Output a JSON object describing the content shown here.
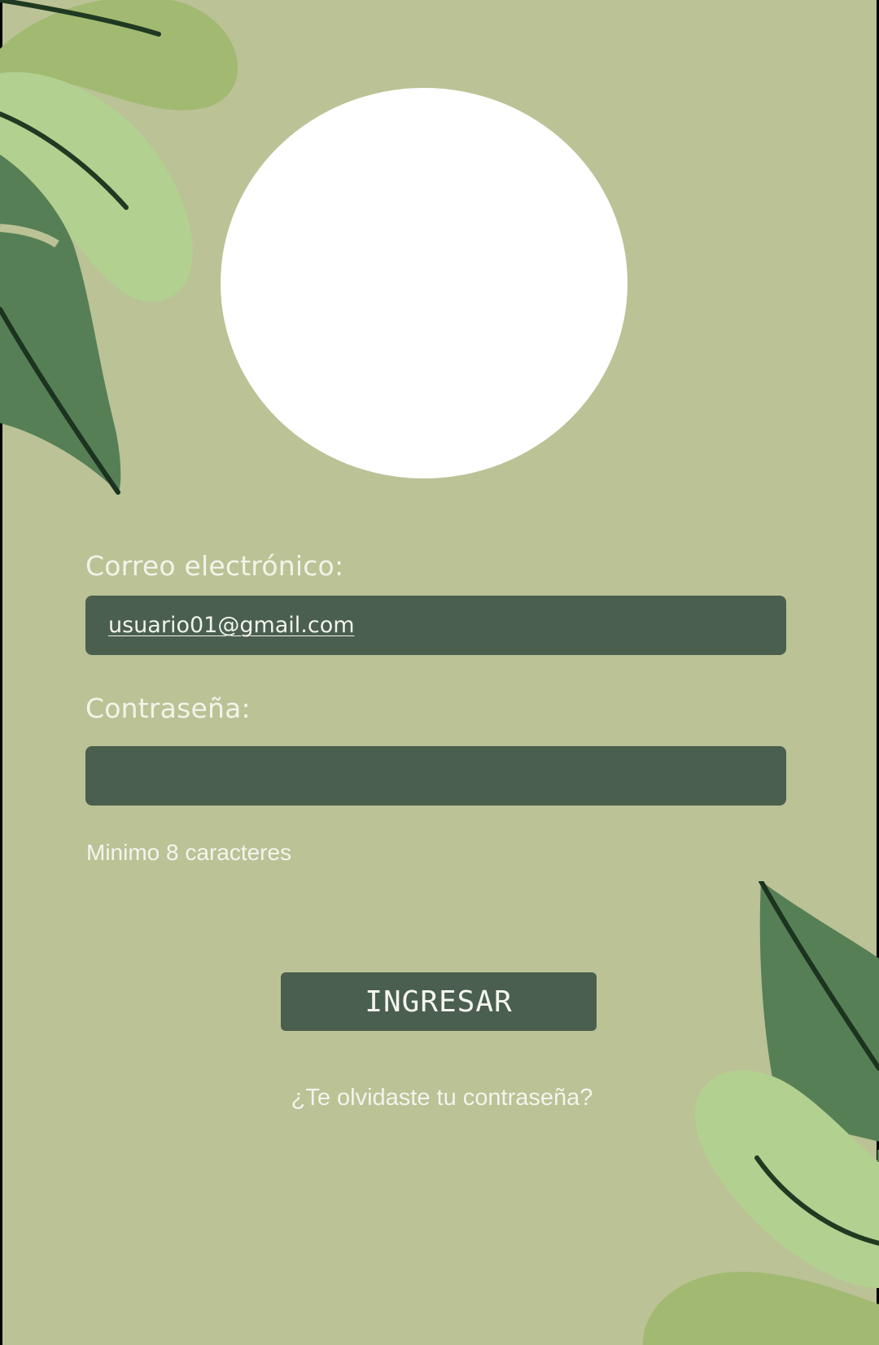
{
  "form": {
    "email_label": "Correo electrónico:",
    "email_value": "usuario01@gmail.com",
    "password_label": "Contraseña:",
    "password_value": "",
    "password_hint": "Minimo 8 caracteres",
    "submit_label": "INGRESAR",
    "forgot_link": "¿Te olvidaste tu contraseña?"
  },
  "colors": {
    "background": "#bbc295",
    "input_fill": "#4a5f4e",
    "leaf_dark": "#567f56",
    "leaf_light": "#b2d08f",
    "leaf_mid": "#a2b971",
    "text": "#f2f4ea"
  },
  "icons": {
    "top_left_decoration": "leaves-decoration-icon",
    "bottom_right_decoration": "leaves-decoration-icon",
    "avatar": "profile-image-placeholder"
  }
}
